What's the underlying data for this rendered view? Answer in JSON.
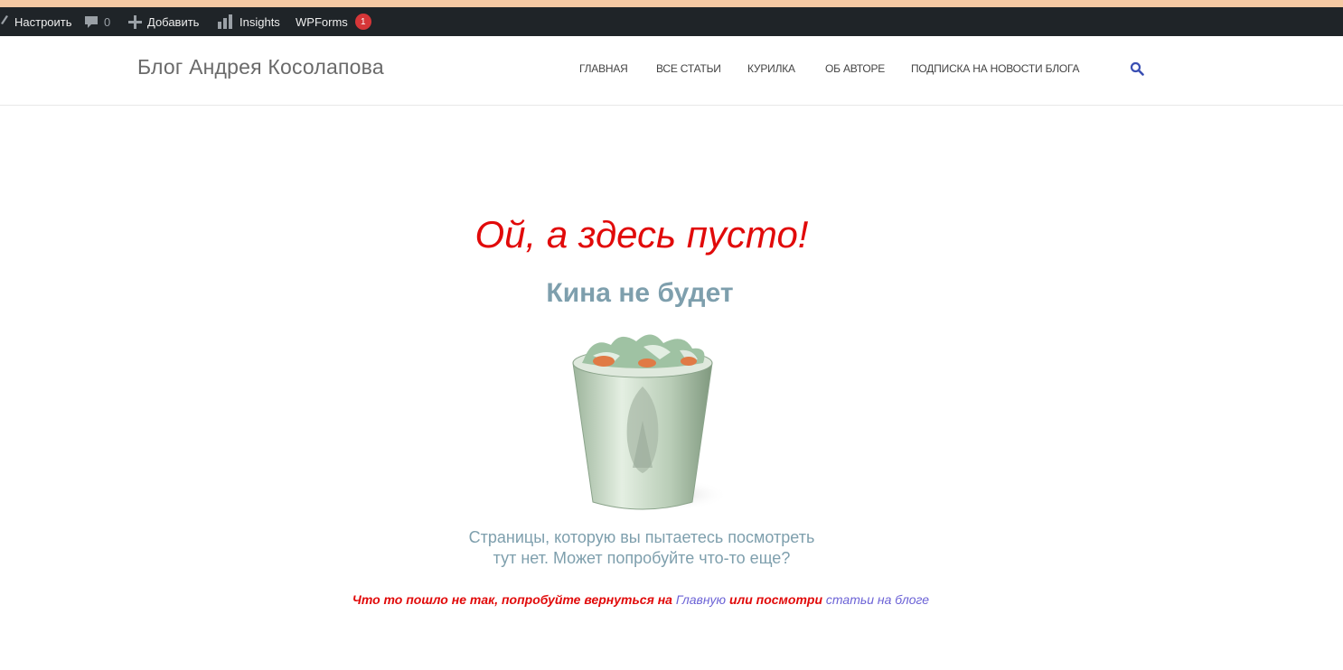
{
  "admin_bar": {
    "customize_label": "Настроить",
    "comments_count": "0",
    "add_label": "Добавить",
    "insights_label": "Insights",
    "wpforms_label": "WPForms",
    "wpforms_badge": "1",
    "icons": [
      "brush-icon",
      "comment-icon",
      "plus-icon",
      "bar-chart-icon"
    ]
  },
  "header": {
    "site_title": "Блог Андрея Косолапова",
    "nav": [
      "ГЛАВНАЯ",
      "ВСЕ СТАТЬИ",
      "КУРИЛКА",
      "ОБ АВТОРЕ",
      "ПОДПИСКА НА НОВОСТИ БЛОГА"
    ],
    "search_icon": "search-icon",
    "accent_color": "#3a4fb3"
  },
  "main": {
    "headline": "Ой, а здесь пусто!",
    "headline_color": "#e10a0a",
    "image": {
      "heading": "Кина не будет",
      "caption_line1": "Страницы, которую вы пытаетесь посмотреть",
      "caption_line2": "тут нет. Может попробуйте что-то еще?",
      "text_color": "#7e9fad"
    },
    "message": {
      "part1": "Что то пошло не так, попробуйте вернуться на ",
      "link_home": "Главную",
      "part2": " или посмотри ",
      "link_articles": "статьи на блоге",
      "link_color": "#6b62d6"
    }
  }
}
